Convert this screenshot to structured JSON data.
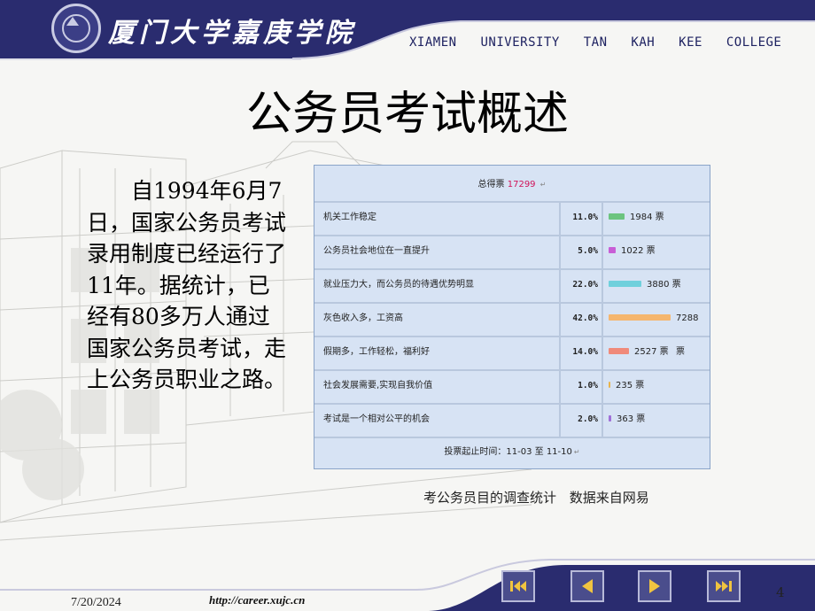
{
  "header": {
    "logo_text": "厦门大学嘉庚学院",
    "college_name": "XIAMEN UNIVERSITY TAN KAH KEE COLLEGE"
  },
  "slide": {
    "title": "公务员考试概述",
    "paragraph": "自1994年6月7日，国家公务员考试录用制度已经运行了11年。据统计，已经有80多万人通过国家公务员考试，走上公务员职业之路。"
  },
  "survey": {
    "total_label": "总得票",
    "total_value": "17299",
    "rows": [
      {
        "label": "机关工作稳定",
        "percent": "11.0%",
        "votes": "1984 票",
        "color": "#6cc47f",
        "share": 0.11
      },
      {
        "label": "公务员社会地位在一直提升",
        "percent": "5.0%",
        "votes": "1022 票",
        "color": "#c85ed6",
        "share": 0.05
      },
      {
        "label": "就业压力大，而公务员的待遇优势明显",
        "percent": "22.0%",
        "votes": "3880 票",
        "color": "#6fd0dc",
        "share": 0.22
      },
      {
        "label": "灰色收入多，工资高",
        "percent": "42.0%",
        "votes": "7288 票",
        "color": "#f5b66e",
        "share": 0.42
      },
      {
        "label": "假期多，工作轻松，福利好",
        "percent": "14.0%",
        "votes": "2527 票",
        "color": "#f08a7a",
        "share": 0.14
      },
      {
        "label": "社会发展需要,实现自我价值",
        "percent": "1.0%",
        "votes": "235 票",
        "color": "#e8b44c",
        "share": 0.01
      },
      {
        "label": "考试是一个相对公平的机会",
        "percent": "2.0%",
        "votes": "363 票",
        "color": "#a070d8",
        "share": 0.02
      }
    ],
    "period": "投票起止时间：11-03 至 11-10"
  },
  "caption": "考公务员目的调查统计 数据来自网易",
  "footer": {
    "date": "7/20/2024",
    "url": "http://career.xujc.cn",
    "page_number": "4",
    "nav": [
      "first-page-icon",
      "previous-page-icon",
      "next-page-icon",
      "last-page-icon"
    ]
  }
}
